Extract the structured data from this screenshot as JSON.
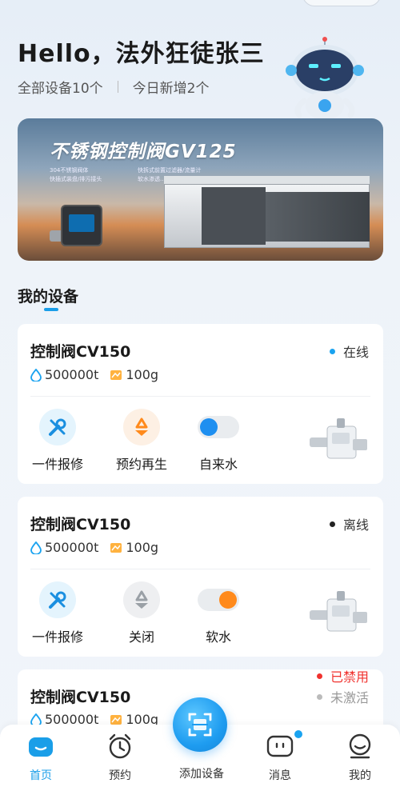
{
  "header": {
    "greeting": "Hello，法外狂徒张三",
    "all_devices": "全部设备10个",
    "new_today": "今日新增2个"
  },
  "banner": {
    "title": "不锈钢控制阀GV125",
    "features": [
      "304不锈钢阀体",
      "快拆式前置过滤器/流量计",
      "快插式装盘/排污接头",
      "软水渗透..."
    ]
  },
  "section": {
    "title": "我的设备"
  },
  "devices": [
    {
      "name": "控制阀CV150",
      "status": "在线",
      "status_color": "#1aa3f0",
      "water": "500000t",
      "salt": "100g",
      "actions": [
        "一件报修",
        "预约再生",
        "自来水"
      ],
      "toggle_on": true
    },
    {
      "name": "控制阀CV150",
      "status": "离线",
      "status_color": "#222222",
      "water": "500000t",
      "salt": "100g",
      "actions": [
        "一件报修",
        "关闭",
        "软水"
      ],
      "toggle_on": false
    },
    {
      "name": "控制阀CV150",
      "status_disabled": "已禁用",
      "status_disabled_color": "#f0322e",
      "status_inactive": "未激活",
      "status_inactive_color": "#bbbbbb",
      "water": "500000t",
      "salt": "100g"
    }
  ],
  "nav": {
    "home": "首页",
    "booking": "预约",
    "add_device": "添加设备",
    "messages": "消息",
    "mine": "我的"
  },
  "colors": {
    "accent": "#1a9ee8",
    "repair_bg": "#e4f4fd",
    "regen_bg": "#fdf0e4",
    "toggle_blue": "#1e8ff0",
    "toggle_orange": "#ff8a1c"
  }
}
